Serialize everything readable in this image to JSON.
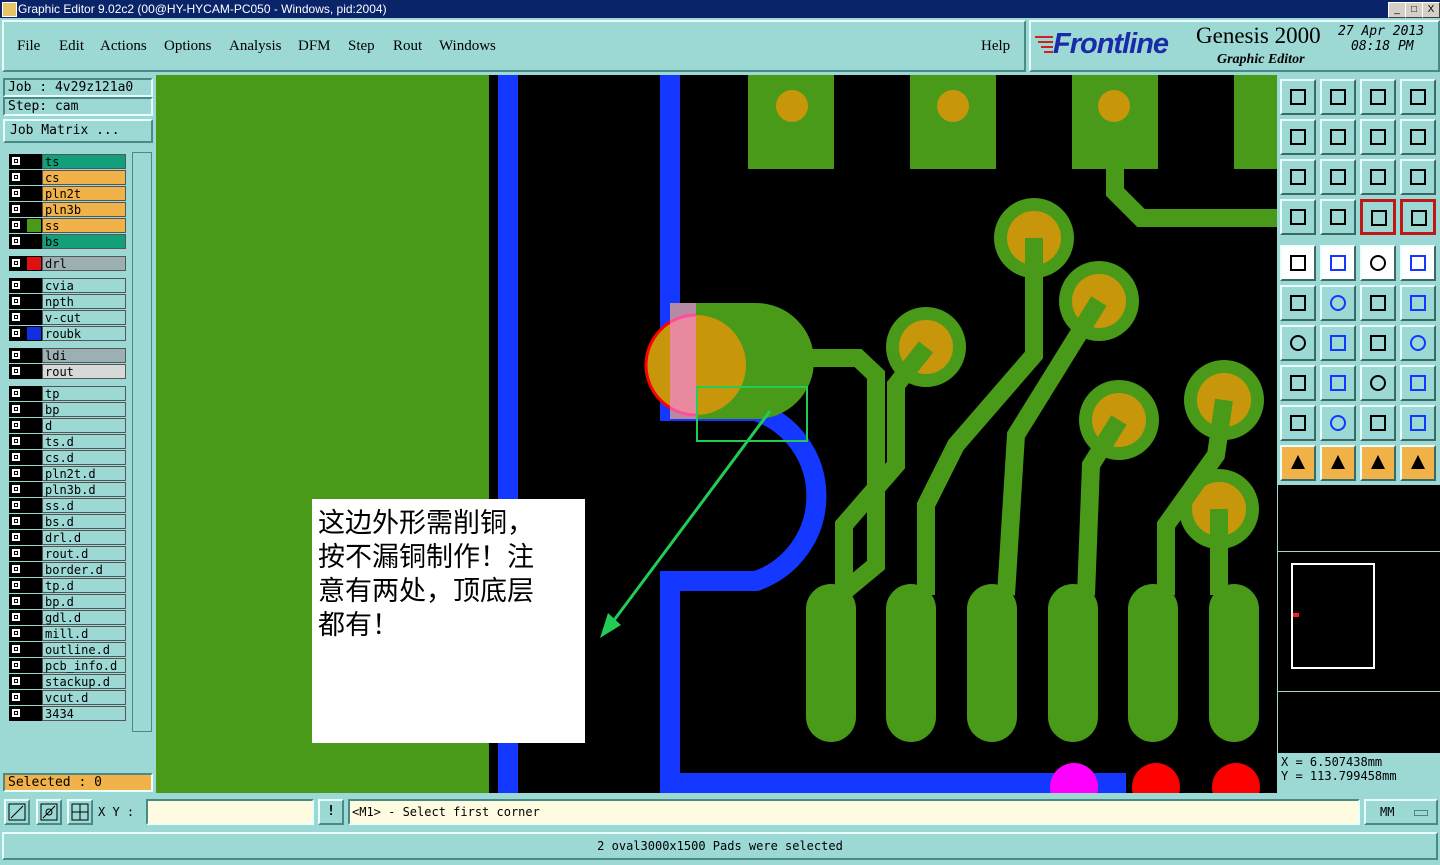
{
  "window": {
    "title": "Graphic Editor 9.02c2 (00@HY-HYCAM-PC050 - Windows, pid:2004)",
    "controls": [
      "_",
      "□",
      "X"
    ]
  },
  "menu": {
    "items": [
      "File",
      "Edit",
      "Actions",
      "Options",
      "Analysis",
      "DFM",
      "Step",
      "Rout",
      "Windows"
    ],
    "help": "Help"
  },
  "brand": {
    "logo": "Frontline",
    "product": "Genesis 2000",
    "subtitle": "Graphic Editor",
    "date": "27 Apr 2013",
    "time": "08:18 PM"
  },
  "job": {
    "job_label": "Job : 4v29z121a0",
    "step_label": "Step: cam",
    "matrix_button": "Job Matrix ..."
  },
  "layers": [
    {
      "name": "ts",
      "color": "#12a07a",
      "swatch": "#000000"
    },
    {
      "name": "cs",
      "color": "#f2b24a",
      "swatch": "#000000"
    },
    {
      "name": "pln2t",
      "color": "#f2b24a",
      "swatch": "#000000"
    },
    {
      "name": "pln3b",
      "color": "#f2b24a",
      "swatch": "#000000"
    },
    {
      "name": "ss",
      "color": "#f2b24a",
      "swatch": "#4a9a1a"
    },
    {
      "name": "bs",
      "color": "#12a07a",
      "swatch": "#000000"
    },
    {
      "name": "drl",
      "color": "#9cb0b4",
      "swatch": "#e01010",
      "gap": true
    },
    {
      "name": "cvia",
      "color": "#9cd8d4",
      "swatch": "#000000",
      "gap": true
    },
    {
      "name": "npth",
      "color": "#9cd8d4",
      "swatch": "#000000"
    },
    {
      "name": "v-cut",
      "color": "#9cd8d4",
      "swatch": "#000000"
    },
    {
      "name": "roubk",
      "color": "#9cd8d4",
      "swatch": "#1030e0"
    },
    {
      "name": "ldi",
      "color": "#9cb0b4",
      "swatch": "#000000",
      "gap": true
    },
    {
      "name": "rout",
      "color": "#d8d8d8",
      "swatch": "#000000"
    },
    {
      "name": "tp",
      "color": "#9cd8d4",
      "swatch": "#000000",
      "gap": true
    },
    {
      "name": "bp",
      "color": "#9cd8d4",
      "swatch": "#000000"
    },
    {
      "name": "d",
      "color": "#9cd8d4",
      "swatch": "#000000"
    },
    {
      "name": "ts.d",
      "color": "#9cd8d4",
      "swatch": "#000000"
    },
    {
      "name": "cs.d",
      "color": "#9cd8d4",
      "swatch": "#000000"
    },
    {
      "name": "pln2t.d",
      "color": "#9cd8d4",
      "swatch": "#000000"
    },
    {
      "name": "pln3b.d",
      "color": "#9cd8d4",
      "swatch": "#000000"
    },
    {
      "name": "ss.d",
      "color": "#9cd8d4",
      "swatch": "#000000"
    },
    {
      "name": "bs.d",
      "color": "#9cd8d4",
      "swatch": "#000000"
    },
    {
      "name": "drl.d",
      "color": "#9cd8d4",
      "swatch": "#000000"
    },
    {
      "name": "rout.d",
      "color": "#9cd8d4",
      "swatch": "#000000"
    },
    {
      "name": "border.d",
      "color": "#9cd8d4",
      "swatch": "#000000"
    },
    {
      "name": "tp.d",
      "color": "#9cd8d4",
      "swatch": "#000000"
    },
    {
      "name": "bp.d",
      "color": "#9cd8d4",
      "swatch": "#000000"
    },
    {
      "name": "gdl.d",
      "color": "#9cd8d4",
      "swatch": "#000000"
    },
    {
      "name": "mill.d",
      "color": "#9cd8d4",
      "swatch": "#000000"
    },
    {
      "name": "outline.d",
      "color": "#9cd8d4",
      "swatch": "#000000"
    },
    {
      "name": "pcb_info.d",
      "color": "#9cd8d4",
      "swatch": "#000000"
    },
    {
      "name": "stackup.d",
      "color": "#9cd8d4",
      "swatch": "#000000"
    },
    {
      "name": "vcut.d",
      "color": "#9cd8d4",
      "swatch": "#000000"
    },
    {
      "name": "3434",
      "color": "#9cd8d4",
      "swatch": "#000000"
    }
  ],
  "selected": "Selected : 0",
  "annotation": {
    "lines": [
      "这边外形需削铜，",
      "按不漏铜制作！注",
      "意有两处，顶底层",
      "都有！"
    ]
  },
  "coords": {
    "x": "X  =   6.507438mm",
    "y": "Y  = 113.799458mm"
  },
  "cmdbar": {
    "xy_label": "X Y :",
    "xy_value": "",
    "prompt": "<M1> - Select first corner",
    "units": "MM"
  },
  "status": "2 oval3000x1500 Pads were selected",
  "colors": {
    "copper": "#4a9a1a",
    "pad": "#c8960a",
    "rout": "#1438ff",
    "highlight": "#ff00ff",
    "drill": "#ff0000",
    "selection_box": "#22cc55"
  }
}
